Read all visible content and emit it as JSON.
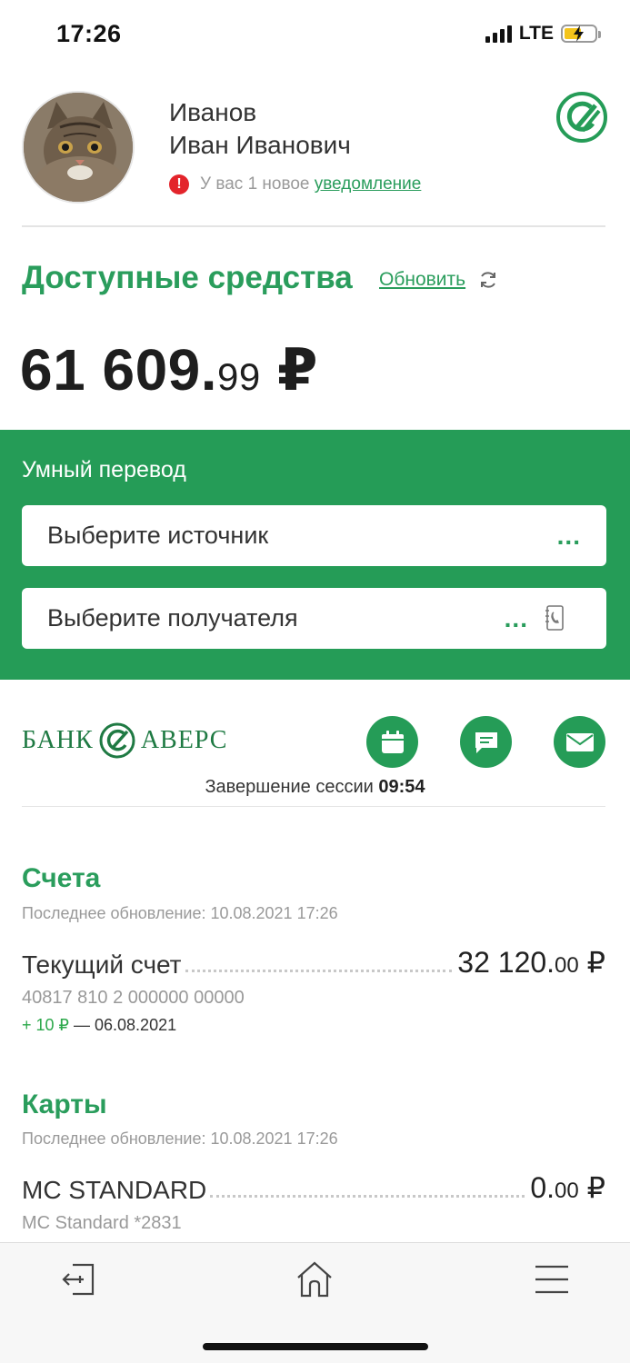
{
  "status_bar": {
    "time": "17:26",
    "network": "LTE"
  },
  "profile": {
    "last_name": "Иванов",
    "first_middle": "Иван Иванович",
    "notice_text": "У вас 1 новое",
    "notice_link": "уведомление"
  },
  "funds": {
    "title": "Доступные средства",
    "refresh_label": "Обновить",
    "balance_main": "61 609.",
    "balance_kop": "99",
    "currency": "₽"
  },
  "smart_transfer": {
    "title": "Умный перевод",
    "source_placeholder": "Выберите источник",
    "recipient_placeholder": "Выберите получателя",
    "dots": "..."
  },
  "bank": {
    "name_left": "БАНК",
    "name_right": "АВЕРС"
  },
  "session": {
    "label": "Завершение сессии",
    "remaining": "09:54"
  },
  "accounts": {
    "title": "Счета",
    "updated": "Последнее обновление: 10.08.2021 17:26",
    "items": [
      {
        "name": "Текущий счет",
        "amount_main": "32 120.",
        "amount_kop": "00",
        "currency": "₽",
        "number": "40817 810 2 000000 00000",
        "last_change": "+ 10 ₽",
        "last_change_date": "— 06.08.2021"
      }
    ]
  },
  "cards": {
    "title": "Карты",
    "updated": "Последнее обновление: 10.08.2021 17:26",
    "items": [
      {
        "name": "MC STANDARD",
        "amount_main": "0.",
        "amount_kop": "00",
        "currency": "₽",
        "description": "MC Standard *2831"
      }
    ]
  },
  "colors": {
    "brand_green": "#259c57",
    "link_green": "#2a9d5c",
    "alert_red": "#e3242b"
  },
  "icons": [
    "signal-icon",
    "battery-icon",
    "alert-icon",
    "refresh-icon",
    "calendar-icon",
    "chat-icon",
    "mail-icon",
    "contact-book-icon",
    "logout-icon",
    "home-icon",
    "menu-icon"
  ]
}
